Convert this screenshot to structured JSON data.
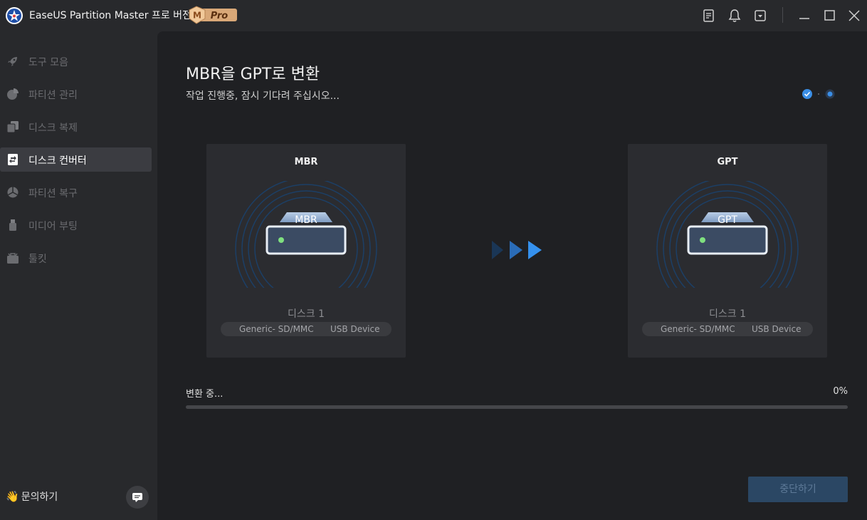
{
  "app": {
    "title": "EaseUS Partition Master 프로 버전",
    "badge": {
      "letter": "M",
      "text": "Pro"
    }
  },
  "titlebar_icons": [
    "notes-icon",
    "bell-icon",
    "dropdown-menu-icon",
    "minimize-icon",
    "maximize-icon",
    "close-icon"
  ],
  "sidebar": {
    "items": [
      {
        "label": "도구 모음",
        "icon": "rocket-icon",
        "active": false
      },
      {
        "label": "파티션 관리",
        "icon": "pie-chart-icon",
        "active": false
      },
      {
        "label": "디스크 복제",
        "icon": "clone-icon",
        "active": false
      },
      {
        "label": "디스크 컨버터",
        "icon": "disk-converter-icon",
        "active": true
      },
      {
        "label": "파티션 복구",
        "icon": "partition-recovery-icon",
        "active": false
      },
      {
        "label": "미디어 부팅",
        "icon": "usb-drive-icon",
        "active": false
      },
      {
        "label": "툴킷",
        "icon": "toolkit-icon",
        "active": false
      }
    ],
    "contact": {
      "emoji": "👋",
      "label": "문의하기"
    }
  },
  "main": {
    "title": "MBR을 GPT로 변환",
    "subtitle": "작업 진행중, 잠시 기다려 주십시오...",
    "steps": {
      "total": 2,
      "completed": 1,
      "current": 2
    },
    "source": {
      "heading": "MBR",
      "disk_label": "MBR",
      "disk_name": "디스크 1",
      "model": "Generic- SD/MMC",
      "interface": "USB Device"
    },
    "target": {
      "heading": "GPT",
      "disk_label": "GPT",
      "disk_name": "디스크 1",
      "model": "Generic- SD/MMC",
      "interface": "USB Device"
    },
    "progress": {
      "label": "변환 중...",
      "value_text": "0%",
      "percent": 0
    },
    "stop_button": "중단하기"
  },
  "colors": {
    "accent": "#2f7fe0",
    "sidebar_bg": "#28292c",
    "main_bg": "#1f2023",
    "card_bg": "#2b2c30",
    "led": "#7fe07f"
  }
}
